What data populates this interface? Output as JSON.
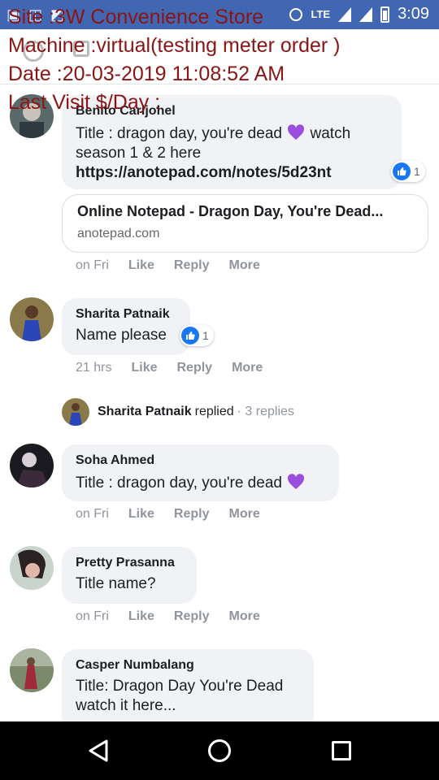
{
  "status_bar": {
    "network": "LTE",
    "time": "3:09",
    "icon_names": [
      "image-icon",
      "chat-icon",
      "cast-icon",
      "alarm-icon",
      "signal-icon",
      "battery-icon"
    ]
  },
  "overlay": {
    "line1": "Site :3W Convenience Store",
    "line2": "Machine :virtual(testing meter order )",
    "line3": "Date :20-03-2019 11:08:52 AM",
    "line4": "Last Visit $/Day :"
  },
  "comments": [
    {
      "author": "Benito Carljohel",
      "text": "Title : dragon day, you're dead",
      "text2": "watch",
      "text3": "season 1 & 2 here",
      "link": "https://anotepad.com/notes/5d23nt",
      "reactions": "1",
      "time": "on Fri",
      "like": "Like",
      "reply": "Reply",
      "more": "More",
      "link_card": {
        "title": "Online Notepad - Dragon Day, You're Dead...",
        "domain": "anotepad.com"
      }
    },
    {
      "author": "Sharita Patnaik",
      "text": "Name please",
      "reactions": "1",
      "time": "21 hrs",
      "like": "Like",
      "reply": "Reply",
      "more": "More",
      "replies": {
        "name": "Sharita Patnaik",
        "word": "replied",
        "count": "· 3 replies"
      }
    },
    {
      "author": "Soha Ahmed",
      "text": "Title : dragon day, you're dead",
      "time": "on Fri",
      "like": "Like",
      "reply": "Reply",
      "more": "More"
    },
    {
      "author": "Pretty Prasanna",
      "text": "Title name?",
      "time": "on Fri",
      "like": "Like",
      "reply": "Reply",
      "more": "More"
    },
    {
      "author": "Casper Numbalang",
      "text": "Title: Dragon Day You're Dead",
      "text2": "watch it here..."
    }
  ],
  "colors": {
    "brand": "#4267b2",
    "bubble": "#f0f2f5",
    "overlay_text": "#8b1414",
    "like_blue": "#1877f2",
    "heart_purple": "#9b4dde"
  }
}
